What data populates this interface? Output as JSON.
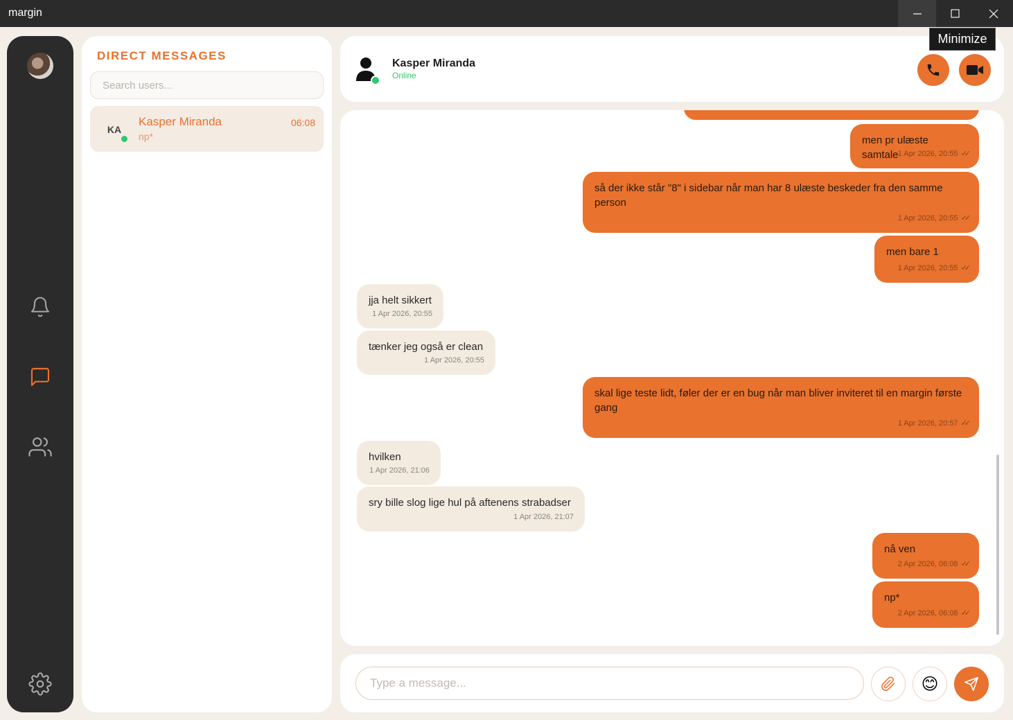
{
  "window": {
    "title": "margin",
    "tooltip": "Minimize",
    "controls": [
      "minimize-icon",
      "maximize-icon",
      "close-icon"
    ]
  },
  "rail": {
    "icons": [
      "bell-icon",
      "chat-icon",
      "users-icon",
      "gear-icon"
    ],
    "active": "chat-icon"
  },
  "dm_panel": {
    "title": "DIRECT MESSAGES",
    "search_placeholder": "Search users...",
    "conversations": [
      {
        "initials": "KA",
        "name": "Kasper Miranda",
        "preview": "np*",
        "time": "06:08",
        "online": true
      }
    ]
  },
  "chat": {
    "contact_name": "Kasper Miranda",
    "contact_status": "Online",
    "actions": [
      "phone-icon",
      "video-icon"
    ],
    "messages": [
      {
        "direction": "out",
        "text": "men pr ulæste samtale",
        "meta": "1 Apr 2026, 20:55"
      },
      {
        "direction": "out",
        "text": "så der ikke står \"8\" i sidebar når man har 8 ulæste beskeder fra den samme person",
        "meta": "1 Apr 2026, 20:55"
      },
      {
        "direction": "out",
        "text": "men bare 1",
        "meta": "1 Apr 2026, 20:55"
      },
      {
        "direction": "in",
        "text": "jja helt sikkert",
        "meta": "1 Apr 2026, 20:55"
      },
      {
        "direction": "in",
        "text": "tænker jeg også er clean",
        "meta": "1 Apr 2026, 20:55"
      },
      {
        "direction": "out",
        "text": "skal lige teste lidt, føler der er en bug når man bliver inviteret til en margin første gang",
        "meta": "1 Apr 2026, 20:57"
      },
      {
        "direction": "in",
        "text": "hvilken",
        "meta": "1 Apr 2026, 21:06"
      },
      {
        "direction": "in",
        "text": "sry bille slog lige hul på aftenens strabadser",
        "meta": "1 Apr 2026, 21:07"
      },
      {
        "direction": "out",
        "text": "nå ven",
        "meta": "2 Apr 2026, 06:08"
      },
      {
        "direction": "out",
        "text": "np*",
        "meta": "2 Apr 2026, 06:08"
      }
    ]
  },
  "composer": {
    "placeholder": "Type a message...",
    "buttons": [
      "paperclip-icon",
      "emoji-icon",
      "send-icon"
    ],
    "emoji": "😊"
  },
  "colors": {
    "accent": "#e8722e",
    "online": "#2cc96e",
    "rail_bg": "#2b2b2b",
    "app_bg": "#f3efe8",
    "incoming_bubble": "#f3ebe0"
  }
}
